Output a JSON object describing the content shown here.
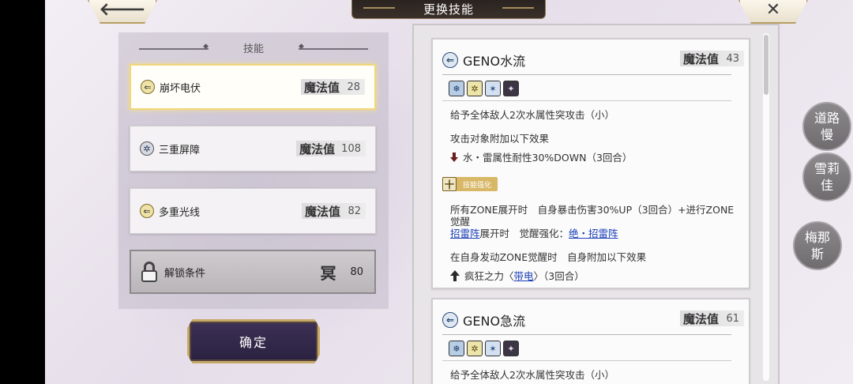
{
  "header": {
    "title": "更换技能",
    "back_glyph": "🡐",
    "close_glyph": "✕"
  },
  "skill_list": {
    "heading": "技能",
    "items": [
      {
        "icon": "thunder-wave-icon",
        "name": "崩坏电伏",
        "mp_label": "魔法值",
        "mp": "28",
        "selected": true
      },
      {
        "icon": "snowflake-icon",
        "name": "三重屏障",
        "mp_label": "魔法值",
        "mp": "108",
        "selected": false
      },
      {
        "icon": "thunder-wave-icon",
        "name": "多重光线",
        "mp_label": "魔法值",
        "mp": "82",
        "selected": false
      }
    ],
    "locked": {
      "icon": "lock-icon",
      "label": "解锁条件",
      "req_icon": "冥",
      "req_value": "80"
    },
    "confirm_label": "确定"
  },
  "detail_cards": [
    {
      "title": "GENO水流",
      "mp_label": "魔法值",
      "mp": "43",
      "tags": [
        "❄",
        "✲",
        "✶",
        "✦"
      ],
      "desc": "给予全体敌人2次水属性突攻击（小）",
      "effect_head": "攻击对象附加以下效果",
      "effect_line": "水・雷属性耐性30%DOWN（3回合）",
      "boost_icon": "十",
      "boost_label": "技能强化",
      "zone_text": "所有ZONE展开时　自身暴击伤害30%UP（3回合）+进行ZONE觉醒",
      "zone_link1": "招雷阵",
      "zone_mid": "展开时　觉醒强化：",
      "zone_link2": "绝・招雷阵",
      "awaken_head": "在自身发动ZONE觉醒时　自身附加以下效果",
      "awaken_pre": "疯狂之力〈",
      "awaken_link": "带电",
      "awaken_post": "〉（3回合）"
    },
    {
      "title": "GENO急流",
      "mp_label": "魔法值",
      "mp": "61",
      "tags": [
        "❄",
        "✲",
        "✶",
        "✦"
      ],
      "desc": "给予全体敌人2次水属性突攻击（小）"
    }
  ],
  "party": [
    "道路慢",
    "雪莉佳",
    "梅那斯"
  ],
  "colors": {
    "accent_gold": "#c7a969",
    "link_blue": "#1a3fb8",
    "selected_glow": "#f1d77a"
  }
}
